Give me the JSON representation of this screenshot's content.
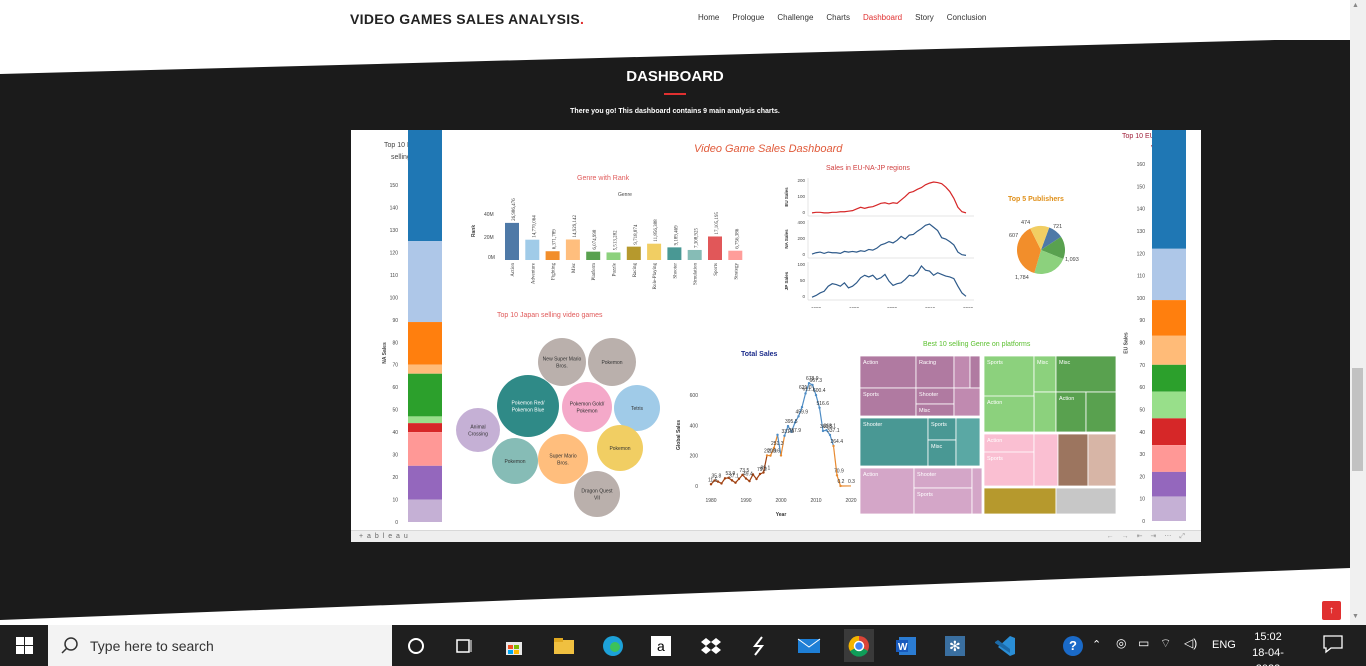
{
  "site": {
    "brand": "VIDEO GAMES SALES ANALYSIS",
    "brand_dot": ".",
    "nav": [
      "Home",
      "Prologue",
      "Challenge",
      "Charts",
      "Dashboard",
      "Story",
      "Conclusion"
    ],
    "active_nav": "Dashboard",
    "section_title": "DASHBOARD",
    "section_subtitle": "There you go! This dashboard contains 9 main analysis charts.",
    "accent_color": "#e03030"
  },
  "dashboard": {
    "title": "Video Game Sales Dashboard",
    "tableau_label": "+ a b l e a u",
    "top10_na": {
      "title_line1": "Top 10 N.A's",
      "title_line2": "selling Vg",
      "axis_label": "NA Sales",
      "ticks": [
        "150",
        "140",
        "130",
        "120",
        "110",
        "100",
        "90",
        "80",
        "70",
        "60",
        "50",
        "40",
        "30",
        "20",
        "10",
        "0"
      ]
    },
    "top10_eu": {
      "title_line1": "Top 10 EU selling",
      "title_line2": "Vg",
      "axis_label": "EU Sales",
      "ticks": [
        "160",
        "150",
        "140",
        "130",
        "120",
        "110",
        "100",
        "90",
        "80",
        "70",
        "60",
        "50",
        "40",
        "30",
        "20",
        "10",
        "0"
      ]
    },
    "genre_rank": {
      "title": "Genre with Rank",
      "subtitle": "Genre",
      "ylabel": "Rank",
      "yticks": [
        "40M",
        "20M",
        "0M"
      ]
    },
    "regions": {
      "title": "Sales in EU-NA-JP regions",
      "labels": [
        "EU Sales",
        "NA Sales",
        "JP Sales"
      ],
      "eu_ticks": [
        "200",
        "100",
        "0"
      ],
      "na_ticks": [
        "400",
        "200",
        "0"
      ],
      "jp_ticks": [
        "100",
        "50",
        "0"
      ],
      "xticks": [
        "1980",
        "1990",
        "2000",
        "2010",
        "2020"
      ],
      "xlabel": "Year"
    },
    "publishers": {
      "title": "Top 5 Publishers",
      "values": [
        "474",
        "721",
        "607",
        "1,093",
        "1,784"
      ]
    },
    "japan_top10": {
      "title": "Top 10 Japan selling video games",
      "bubbles": [
        "New Super Mario Bros.",
        "Pokemon",
        "Pokemon Red/Pokemon Blue",
        "Pokemon Gold/Pokemon",
        "Tetris",
        "Animal Crossing",
        "Pokemon",
        "Super Mario Bros.",
        "Pokemon",
        "Dragon Quest VII"
      ]
    },
    "total_sales": {
      "title": "Total Sales",
      "ylabel": "Global Sales",
      "xlabel": "Year",
      "yticks": [
        "600",
        "400",
        "200",
        "0"
      ],
      "xticks": [
        "1980",
        "1990",
        "2000",
        "2010",
        "2020"
      ],
      "point_labels": [
        "11.5",
        "35.8",
        "37.1",
        "53.9",
        "49.4",
        "73.5",
        "79.2",
        "89.1",
        "201.9",
        "200.6",
        "251.3",
        "331.5",
        "395.5",
        "459.9",
        "337.9",
        "621.0",
        "611.1",
        "678.9",
        "667.3",
        "600.4",
        "516.6",
        "363.5",
        "368.1",
        "337.1",
        "264.4",
        "70.9",
        "0.2",
        "0.3"
      ]
    },
    "treemap": {
      "title": "Best 10 selling Genre on platforms",
      "labels": [
        "Action",
        "Racing",
        "Shooter",
        "Misc",
        "Sports",
        "Sports",
        "Misc",
        "Misc",
        "Action",
        "Action",
        "Shooter",
        "Sports",
        "Misc",
        "Action",
        "Sports",
        "Action",
        "Shooter",
        "Sports"
      ]
    }
  },
  "chart_data": [
    {
      "type": "bar",
      "title": "Top 10 N.A's selling Vg",
      "ylabel": "NA Sales",
      "ylim": [
        0,
        150
      ],
      "values": [
        146,
        36,
        19,
        4,
        19,
        3,
        4,
        15,
        15,
        10
      ]
    },
    {
      "type": "bar",
      "title": "Top 10 EU selling Vg",
      "ylabel": "EU Sales",
      "ylim": [
        0,
        160
      ],
      "values": [
        153,
        23,
        16,
        13,
        12,
        12,
        12,
        12,
        11,
        11
      ]
    },
    {
      "type": "bar",
      "title": "Genre with Rank",
      "xlabel": "Genre",
      "ylabel": "Rank",
      "ylim": [
        0,
        40000000
      ],
      "categories": [
        "Action",
        "Adventure",
        "Fighting",
        "Misc",
        "Platform",
        "Puzzle",
        "Racing",
        "Role-Playing",
        "Shooter",
        "Simulation",
        "Sports",
        "Strategy"
      ],
      "values": [
        26986476,
        14770064,
        6371789,
        14929142,
        6074998,
        5513282,
        9718874,
        11856388,
        9189469,
        7308925,
        17105195,
        6756386
      ],
      "value_labels": [
        "26,986,476",
        "14,770,064",
        "6,371,789",
        "14,929,142",
        "6,074,998",
        "5,513,282",
        "9,718,874",
        "11,856,388",
        "9,189,469",
        "7,308,925",
        "17,105,195",
        "6,756,386"
      ]
    },
    {
      "type": "pie",
      "title": "Top 5 Publishers",
      "values": [
        474,
        721,
        1093,
        1784,
        607
      ]
    },
    {
      "type": "line",
      "title": "Total Sales",
      "xlabel": "Year",
      "ylabel": "Global Sales",
      "ylim": [
        0,
        700
      ],
      "x": [
        1980,
        1981,
        1982,
        1983,
        1984,
        1985,
        1986,
        1987,
        1988,
        1989,
        1990,
        1991,
        1992,
        1993,
        1994,
        1995,
        1996,
        1997,
        1998,
        1999,
        2000,
        2001,
        2002,
        2003,
        2004,
        2005,
        2006,
        2007,
        2008,
        2009,
        2010,
        2011,
        2012,
        2013,
        2014,
        2015,
        2016,
        2017,
        2020
      ],
      "series": [
        {
          "values": [
            11.5,
            35.8,
            28.9,
            16.8,
            50.4,
            53.9,
            37.1,
            21.7,
            47.2,
            73.5,
            49.4,
            32.2,
            76.2,
            45.9,
            79.2,
            89.1,
            201.9,
            200.6,
            251.3,
            337.9,
            201.6,
            331.5,
            395.5,
            357.9,
            419.3,
            459.9,
            521.0,
            611.1,
            678.9,
            667.3,
            600.4,
            516.6,
            363.5,
            368.1,
            337.1,
            264.4,
            70.9,
            0.2,
            0.3
          ]
        }
      ]
    }
  ]
}
